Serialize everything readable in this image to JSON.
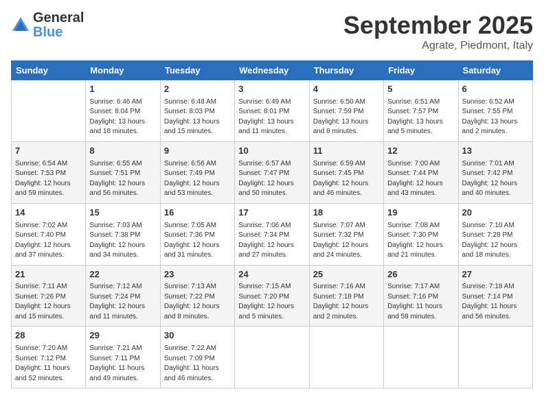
{
  "logo": {
    "general": "General",
    "blue": "Blue"
  },
  "header": {
    "month": "September 2025",
    "location": "Agrate, Piedmont, Italy"
  },
  "weekdays": [
    "Sunday",
    "Monday",
    "Tuesday",
    "Wednesday",
    "Thursday",
    "Friday",
    "Saturday"
  ],
  "weeks": [
    [
      {
        "day": "",
        "info": ""
      },
      {
        "day": "1",
        "info": "Sunrise: 6:46 AM\nSunset: 8:04 PM\nDaylight: 13 hours\nand 18 minutes."
      },
      {
        "day": "2",
        "info": "Sunrise: 6:48 AM\nSunset: 8:03 PM\nDaylight: 13 hours\nand 15 minutes."
      },
      {
        "day": "3",
        "info": "Sunrise: 6:49 AM\nSunset: 8:01 PM\nDaylight: 13 hours\nand 11 minutes."
      },
      {
        "day": "4",
        "info": "Sunrise: 6:50 AM\nSunset: 7:59 PM\nDaylight: 13 hours\nand 8 minutes."
      },
      {
        "day": "5",
        "info": "Sunrise: 6:51 AM\nSunset: 7:57 PM\nDaylight: 13 hours\nand 5 minutes."
      },
      {
        "day": "6",
        "info": "Sunrise: 6:52 AM\nSunset: 7:55 PM\nDaylight: 13 hours\nand 2 minutes."
      }
    ],
    [
      {
        "day": "7",
        "info": "Sunrise: 6:54 AM\nSunset: 7:53 PM\nDaylight: 12 hours\nand 59 minutes."
      },
      {
        "day": "8",
        "info": "Sunrise: 6:55 AM\nSunset: 7:51 PM\nDaylight: 12 hours\nand 56 minutes."
      },
      {
        "day": "9",
        "info": "Sunrise: 6:56 AM\nSunset: 7:49 PM\nDaylight: 12 hours\nand 53 minutes."
      },
      {
        "day": "10",
        "info": "Sunrise: 6:57 AM\nSunset: 7:47 PM\nDaylight: 12 hours\nand 50 minutes."
      },
      {
        "day": "11",
        "info": "Sunrise: 6:59 AM\nSunset: 7:45 PM\nDaylight: 12 hours\nand 46 minutes."
      },
      {
        "day": "12",
        "info": "Sunrise: 7:00 AM\nSunset: 7:44 PM\nDaylight: 12 hours\nand 43 minutes."
      },
      {
        "day": "13",
        "info": "Sunrise: 7:01 AM\nSunset: 7:42 PM\nDaylight: 12 hours\nand 40 minutes."
      }
    ],
    [
      {
        "day": "14",
        "info": "Sunrise: 7:02 AM\nSunset: 7:40 PM\nDaylight: 12 hours\nand 37 minutes."
      },
      {
        "day": "15",
        "info": "Sunrise: 7:03 AM\nSunset: 7:38 PM\nDaylight: 12 hours\nand 34 minutes."
      },
      {
        "day": "16",
        "info": "Sunrise: 7:05 AM\nSunset: 7:36 PM\nDaylight: 12 hours\nand 31 minutes."
      },
      {
        "day": "17",
        "info": "Sunrise: 7:06 AM\nSunset: 7:34 PM\nDaylight: 12 hours\nand 27 minutes."
      },
      {
        "day": "18",
        "info": "Sunrise: 7:07 AM\nSunset: 7:32 PM\nDaylight: 12 hours\nand 24 minutes."
      },
      {
        "day": "19",
        "info": "Sunrise: 7:08 AM\nSunset: 7:30 PM\nDaylight: 12 hours\nand 21 minutes."
      },
      {
        "day": "20",
        "info": "Sunrise: 7:10 AM\nSunset: 7:28 PM\nDaylight: 12 hours\nand 18 minutes."
      }
    ],
    [
      {
        "day": "21",
        "info": "Sunrise: 7:11 AM\nSunset: 7:26 PM\nDaylight: 12 hours\nand 15 minutes."
      },
      {
        "day": "22",
        "info": "Sunrise: 7:12 AM\nSunset: 7:24 PM\nDaylight: 12 hours\nand 11 minutes."
      },
      {
        "day": "23",
        "info": "Sunrise: 7:13 AM\nSunset: 7:22 PM\nDaylight: 12 hours\nand 8 minutes."
      },
      {
        "day": "24",
        "info": "Sunrise: 7:15 AM\nSunset: 7:20 PM\nDaylight: 12 hours\nand 5 minutes."
      },
      {
        "day": "25",
        "info": "Sunrise: 7:16 AM\nSunset: 7:18 PM\nDaylight: 12 hours\nand 2 minutes."
      },
      {
        "day": "26",
        "info": "Sunrise: 7:17 AM\nSunset: 7:16 PM\nDaylight: 11 hours\nand 59 minutes."
      },
      {
        "day": "27",
        "info": "Sunrise: 7:18 AM\nSunset: 7:14 PM\nDaylight: 11 hours\nand 56 minutes."
      }
    ],
    [
      {
        "day": "28",
        "info": "Sunrise: 7:20 AM\nSunset: 7:12 PM\nDaylight: 11 hours\nand 52 minutes."
      },
      {
        "day": "29",
        "info": "Sunrise: 7:21 AM\nSunset: 7:11 PM\nDaylight: 11 hours\nand 49 minutes."
      },
      {
        "day": "30",
        "info": "Sunrise: 7:22 AM\nSunset: 7:09 PM\nDaylight: 11 hours\nand 46 minutes."
      },
      {
        "day": "",
        "info": ""
      },
      {
        "day": "",
        "info": ""
      },
      {
        "day": "",
        "info": ""
      },
      {
        "day": "",
        "info": ""
      }
    ]
  ]
}
